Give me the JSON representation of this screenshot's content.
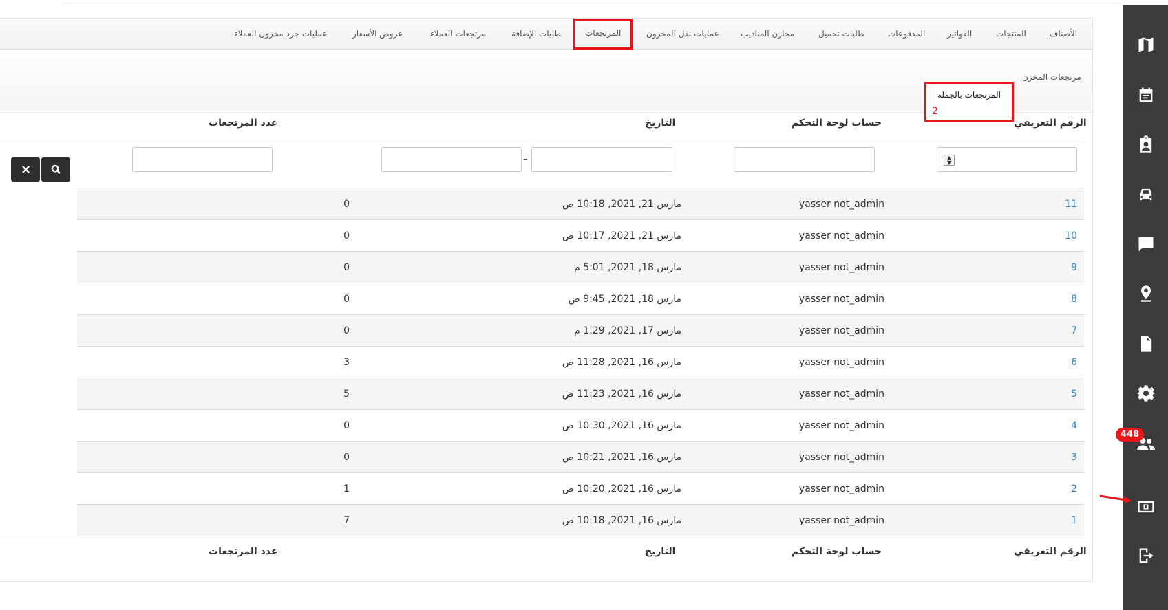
{
  "top_nav": [
    {
      "label": "الأصناف"
    },
    {
      "label": "المنتجات"
    },
    {
      "label": "الفواتير"
    },
    {
      "label": "المدفوعات"
    },
    {
      "label": "طلبات تحميل"
    },
    {
      "label": "مخازن المناديب"
    },
    {
      "label": "عمليات نقل المخزون"
    },
    {
      "label": "المرتجعات"
    },
    {
      "label": "طلبات الإضافة"
    },
    {
      "label": "مرتجعات العملاء"
    },
    {
      "label": "عروض الأسعار"
    },
    {
      "label": "عمليات جرد مخزون العملاء"
    }
  ],
  "sub_nav": {
    "warehouse_returns": "مرتجعات المخزن",
    "bulk_returns": "المرتجعات بالجملة",
    "annotation_number": "2"
  },
  "table": {
    "headers": {
      "id": "الرقم التعريفي",
      "account": "حساب لوحة التحكم",
      "date": "التاريخ",
      "returns_count": "عدد المرتجعات"
    },
    "date_range_separator": "–",
    "rows": [
      {
        "id": "11",
        "account": "yasser not_admin",
        "date": "مارس 21, 2021, 10:18 ص",
        "count": "0"
      },
      {
        "id": "10",
        "account": "yasser not_admin",
        "date": "مارس 21, 2021, 10:17 ص",
        "count": "0"
      },
      {
        "id": "9",
        "account": "yasser not_admin",
        "date": "مارس 18, 2021, 5:01 م",
        "count": "0"
      },
      {
        "id": "8",
        "account": "yasser not_admin",
        "date": "مارس 18, 2021, 9:45 ص",
        "count": "0"
      },
      {
        "id": "7",
        "account": "yasser not_admin",
        "date": "مارس 17, 2021, 1:29 م",
        "count": "0"
      },
      {
        "id": "6",
        "account": "yasser not_admin",
        "date": "مارس 16, 2021, 11:28 ص",
        "count": "3"
      },
      {
        "id": "5",
        "account": "yasser not_admin",
        "date": "مارس 16, 2021, 11:23 ص",
        "count": "5"
      },
      {
        "id": "4",
        "account": "yasser not_admin",
        "date": "مارس 16, 2021, 10:30 ص",
        "count": "0"
      },
      {
        "id": "3",
        "account": "yasser not_admin",
        "date": "مارس 16, 2021, 10:21 ص",
        "count": "0"
      },
      {
        "id": "2",
        "account": "yasser not_admin",
        "date": "مارس 16, 2021, 10:20 ص",
        "count": "1"
      },
      {
        "id": "1",
        "account": "yasser not_admin",
        "date": "مارس 16, 2021, 10:18 ص",
        "count": "7"
      }
    ]
  },
  "sidebar": {
    "icons": [
      "map-icon",
      "calendar-icon",
      "clipboard-user-icon",
      "car-icon",
      "chat-icon",
      "location-icon",
      "document-icon",
      "settings-icon",
      "users-icon",
      "cash-icon",
      "logout-icon"
    ],
    "users_badge": "448"
  },
  "colors": {
    "sidebar_bg": "#3b3b3b",
    "highlight": "#e8161b",
    "link": "#2a7fc0"
  }
}
